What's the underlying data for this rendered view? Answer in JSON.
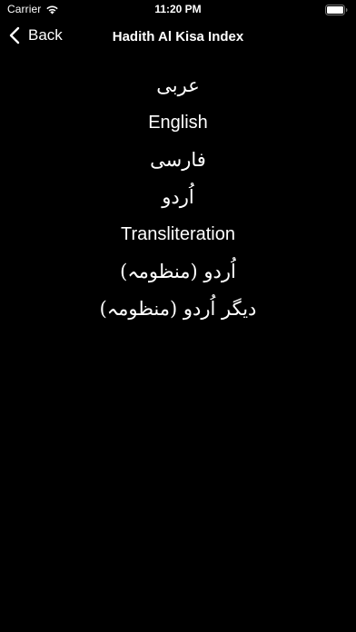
{
  "status_bar": {
    "carrier": "Carrier",
    "time": "11:20 PM",
    "wifi_icon": "wifi-icon",
    "battery_icon": "battery-icon"
  },
  "nav": {
    "back_label": "Back",
    "back_icon": "chevron-left-icon",
    "title": "Hadith Al Kisa Index"
  },
  "index_items": [
    {
      "label": "عربی",
      "lang": "ar",
      "dir": "rtl"
    },
    {
      "label": "English",
      "lang": "en",
      "dir": "ltr"
    },
    {
      "label": "فارسی",
      "lang": "fa",
      "dir": "rtl"
    },
    {
      "label": "اُردو",
      "lang": "ur",
      "dir": "rtl"
    },
    {
      "label": "Transliteration",
      "lang": "en",
      "dir": "ltr"
    },
    {
      "label": "اُردو (منظومہ)",
      "lang": "ur",
      "dir": "rtl"
    },
    {
      "label": "دیگر اُردو (منظومہ)",
      "lang": "ur",
      "dir": "rtl"
    }
  ],
  "colors": {
    "background": "#000000",
    "text": "#ffffff"
  }
}
